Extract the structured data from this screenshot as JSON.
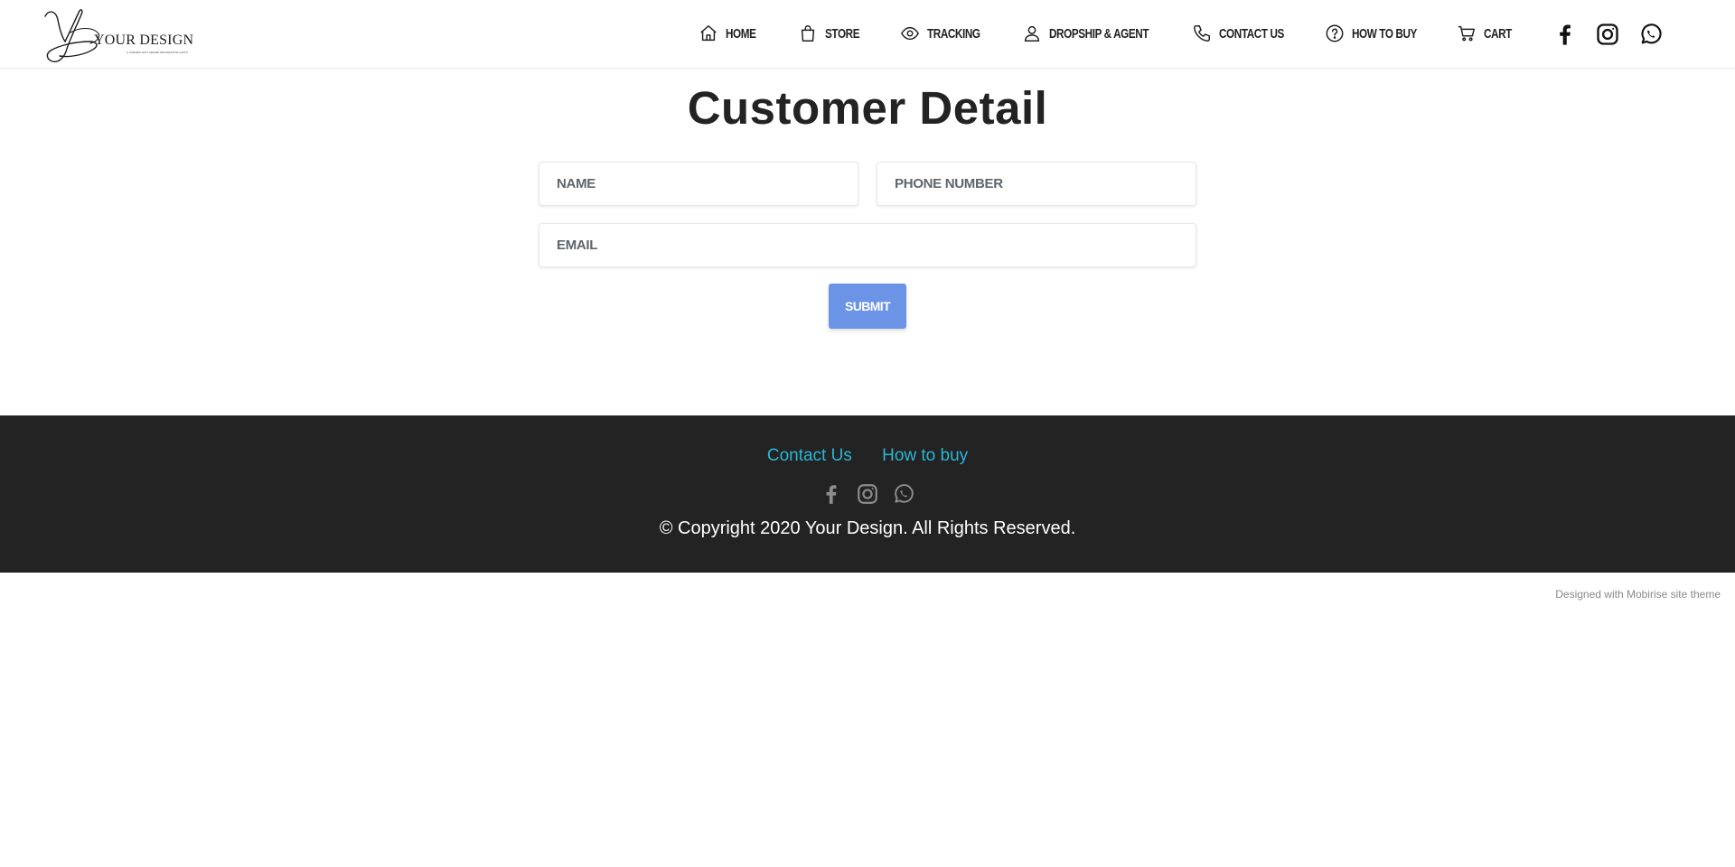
{
  "brand": {
    "name": "YOUR DESIGN",
    "tagline": "A CARVED GIFT AWARD DECORATIVE GIFTS",
    "logo_icon": "script-y-monogram-icon"
  },
  "nav": {
    "items": [
      {
        "label": "HOME",
        "icon": "home-icon"
      },
      {
        "label": "STORE",
        "icon": "shopping-bag-icon"
      },
      {
        "label": "TRACKING",
        "icon": "eye-icon"
      },
      {
        "label": "DROPSHIP & AGENT",
        "icon": "user-icon"
      },
      {
        "label": "CONTACT US",
        "icon": "phone-icon"
      },
      {
        "label": "HOW TO BUY",
        "icon": "question-circle-icon"
      },
      {
        "label": "CART",
        "icon": "cart-icon"
      }
    ],
    "social": [
      {
        "name": "facebook-icon"
      },
      {
        "name": "instagram-icon"
      },
      {
        "name": "whatsapp-icon"
      }
    ]
  },
  "main": {
    "title": "Customer Detail",
    "form": {
      "name_placeholder": "NAME",
      "phone_placeholder": "PHONE NUMBER",
      "email_placeholder": "EMAIL",
      "name_value": "",
      "phone_value": "",
      "email_value": "",
      "submit_label": "SUBMIT"
    }
  },
  "footer": {
    "links": [
      {
        "label": "Contact Us"
      },
      {
        "label": "How to buy"
      }
    ],
    "copyright": "© Copyright 2020 Your Design. All Rights Reserved."
  },
  "credit": "Designed with Mobirise site theme",
  "colors": {
    "accent": "#6b94e6",
    "footer_bg": "#232323",
    "footer_link": "#29b6d4",
    "text": "#232323"
  }
}
